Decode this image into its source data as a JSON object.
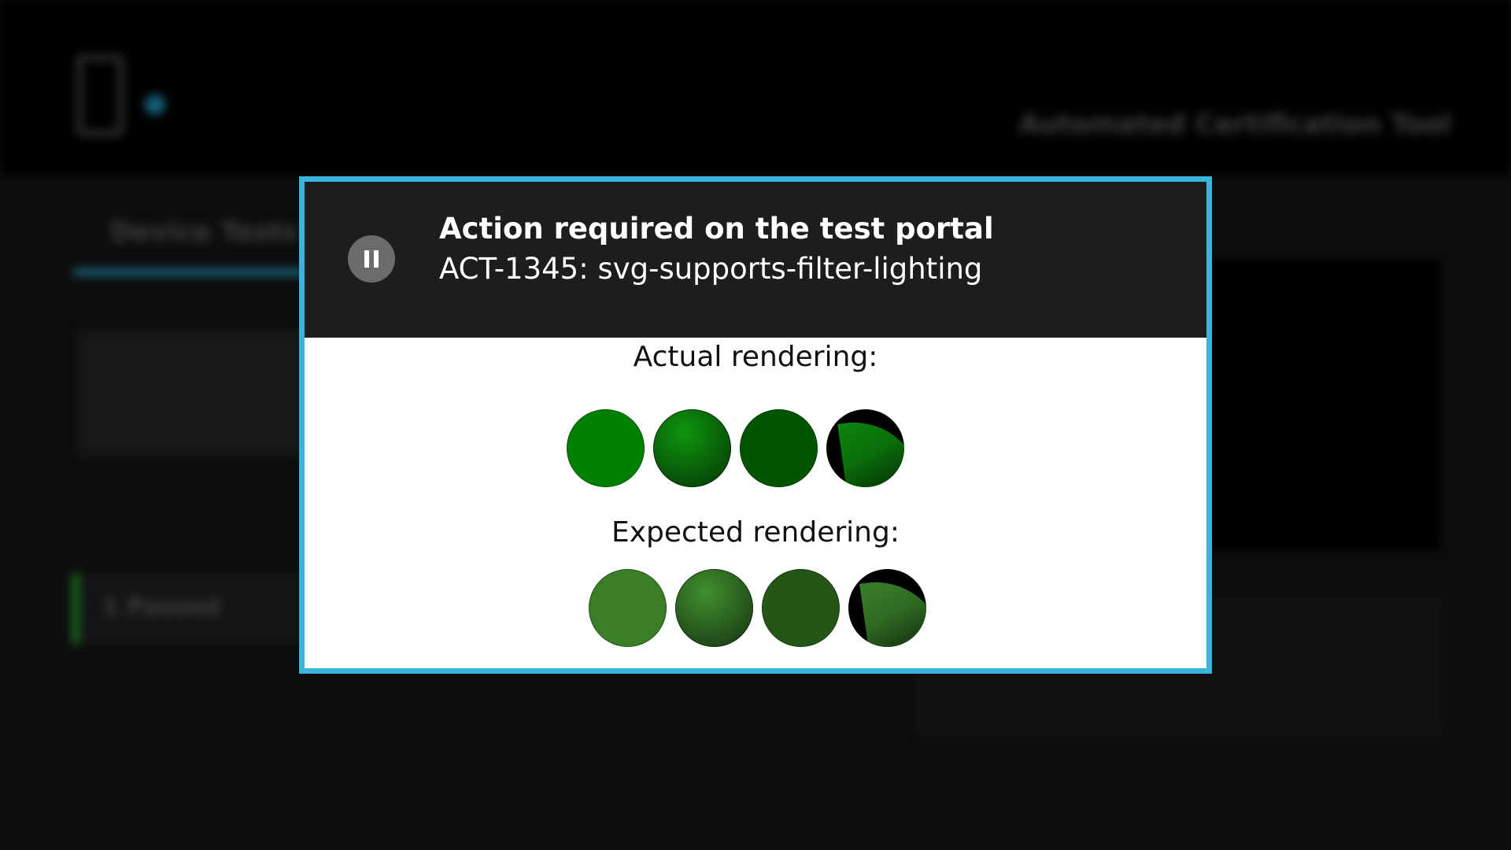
{
  "app": {
    "title": "Automated Certification Tool",
    "active_tab": "Device Tests",
    "status_card": "1 Passed"
  },
  "dialog": {
    "title": "Action required on the test portal",
    "subtitle": "ACT-1345: svg-supports-filter-lighting",
    "pause_icon": "pause-icon",
    "accent_color": "#3bb4dc",
    "actual_label": "Actual rendering:",
    "expected_label": "Expected rendering:",
    "actual_circles": [
      {
        "kind": "flat",
        "color": "#008000"
      },
      {
        "kind": "spot",
        "color": "#0a6e0a"
      },
      {
        "kind": "flat",
        "color": "#005500"
      },
      {
        "kind": "edge",
        "color": "#0a6e0a"
      }
    ],
    "expected_circles": [
      {
        "kind": "flat",
        "color": "#3a7f28"
      },
      {
        "kind": "spot",
        "color": "#2f6a22"
      },
      {
        "kind": "flat",
        "color": "#245618"
      },
      {
        "kind": "edge",
        "color": "#2f6a22"
      }
    ]
  }
}
